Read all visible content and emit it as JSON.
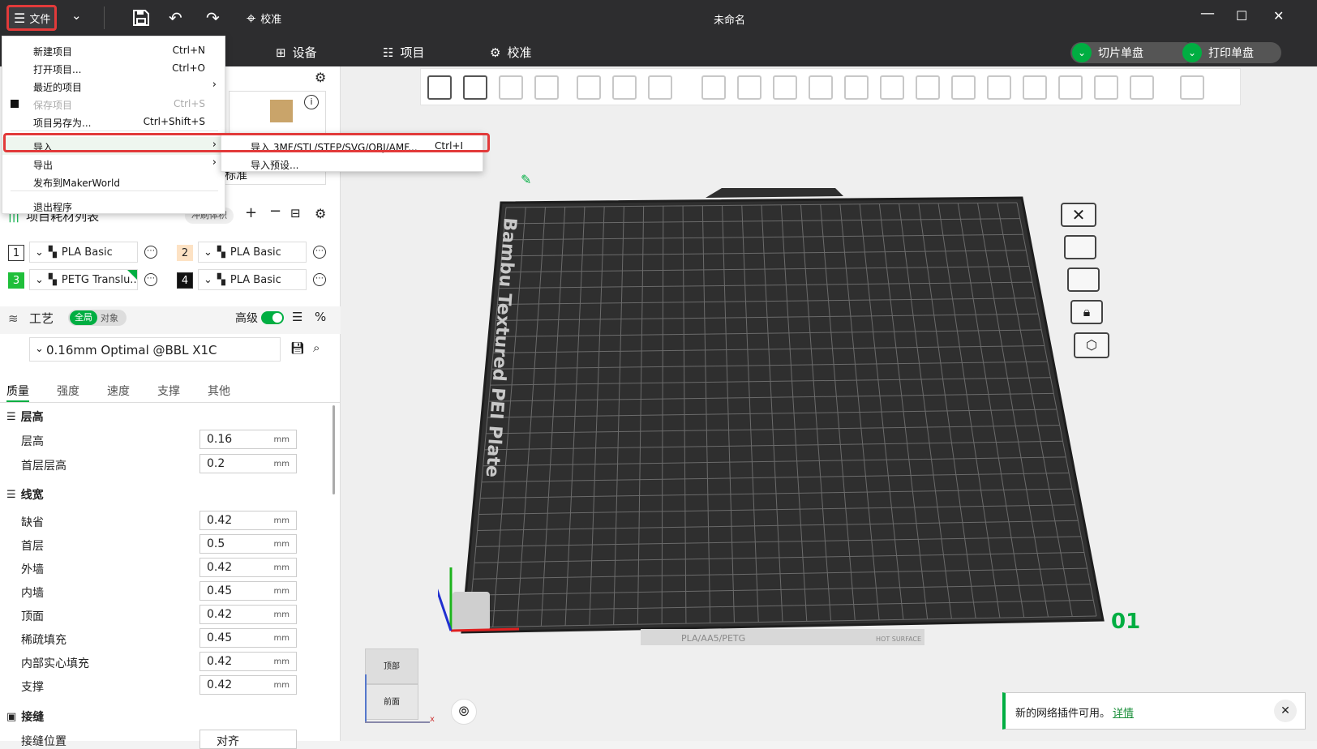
{
  "titlebar": {
    "file_label": "文件",
    "calibrate_label": "校准",
    "window_title": "未命名"
  },
  "tabbar": {
    "tabs": [
      {
        "label": "设备"
      },
      {
        "label": "项目"
      },
      {
        "label": "校准"
      }
    ],
    "slice_button": "切片单盘",
    "print_button": "打印单盘"
  },
  "file_menu": {
    "items": [
      {
        "label": "新建项目",
        "shortcut": "Ctrl+N"
      },
      {
        "label": "打开项目...",
        "shortcut": "Ctrl+O"
      },
      {
        "label": "最近的项目",
        "shortcut": ""
      },
      {
        "label": "保存项目",
        "shortcut": "Ctrl+S"
      },
      {
        "label": "项目另存为...",
        "shortcut": "Ctrl+Shift+S"
      },
      {
        "label": "导入",
        "shortcut": ""
      },
      {
        "label": "导出",
        "shortcut": ""
      },
      {
        "label": "发布到MakerWorld",
        "shortcut": ""
      },
      {
        "label": "退出程序",
        "shortcut": ""
      }
    ]
  },
  "import_submenu": {
    "items": [
      {
        "label": "导入 3MF/STL/STEP/SVG/OBJ/AMF...",
        "shortcut": "Ctrl+I"
      },
      {
        "label": "导入预设..."
      }
    ]
  },
  "plate_partial_label": "标准",
  "filament": {
    "title": "项目耗材列表",
    "flush_label": "冲刷体积",
    "slots": [
      {
        "num": "1",
        "name": "PLA Basic",
        "color": "#ffffff"
      },
      {
        "num": "2",
        "name": "PLA Basic",
        "color": "#fde2c4"
      },
      {
        "num": "3",
        "name": "PETG Translu...",
        "color": "#1fbf3a"
      },
      {
        "num": "4",
        "name": "PLA Basic",
        "color": "#111111"
      }
    ]
  },
  "process": {
    "title": "工艺",
    "global_label": "全局",
    "object_label": "对象",
    "advanced_label": "高级",
    "preset": "0.16mm Optimal @BBL X1C",
    "tabs": [
      "质量",
      "强度",
      "速度",
      "支撑",
      "其他"
    ]
  },
  "quality": {
    "layer_section": "层高",
    "layer_rows": [
      {
        "label": "层高",
        "value": "0.16",
        "unit": "mm"
      },
      {
        "label": "首层层高",
        "value": "0.2",
        "unit": "mm"
      }
    ],
    "width_section": "线宽",
    "width_rows": [
      {
        "label": "缺省",
        "value": "0.42",
        "unit": "mm"
      },
      {
        "label": "首层",
        "value": "0.5",
        "unit": "mm"
      },
      {
        "label": "外墙",
        "value": "0.42",
        "unit": "mm"
      },
      {
        "label": "内墙",
        "value": "0.45",
        "unit": "mm"
      },
      {
        "label": "顶面",
        "value": "0.42",
        "unit": "mm"
      },
      {
        "label": "稀疏填充",
        "value": "0.45",
        "unit": "mm"
      },
      {
        "label": "内部实心填充",
        "value": "0.42",
        "unit": "mm"
      },
      {
        "label": "支撑",
        "value": "0.42",
        "unit": "mm"
      }
    ],
    "seam_section": "接缝",
    "seam_row_label": "接缝位置",
    "seam_row_value": "对齐"
  },
  "plate": {
    "brand_text": "Bambu Textured PEI Plate",
    "plate_number": "01",
    "bottom_text": "PLA/AA5/PETG",
    "hot_text": "HOT SURFACE"
  },
  "view_cube": {
    "top": "顶部",
    "front": "前面"
  },
  "notification": {
    "text": "新的网络插件可用。",
    "link": "详情"
  }
}
